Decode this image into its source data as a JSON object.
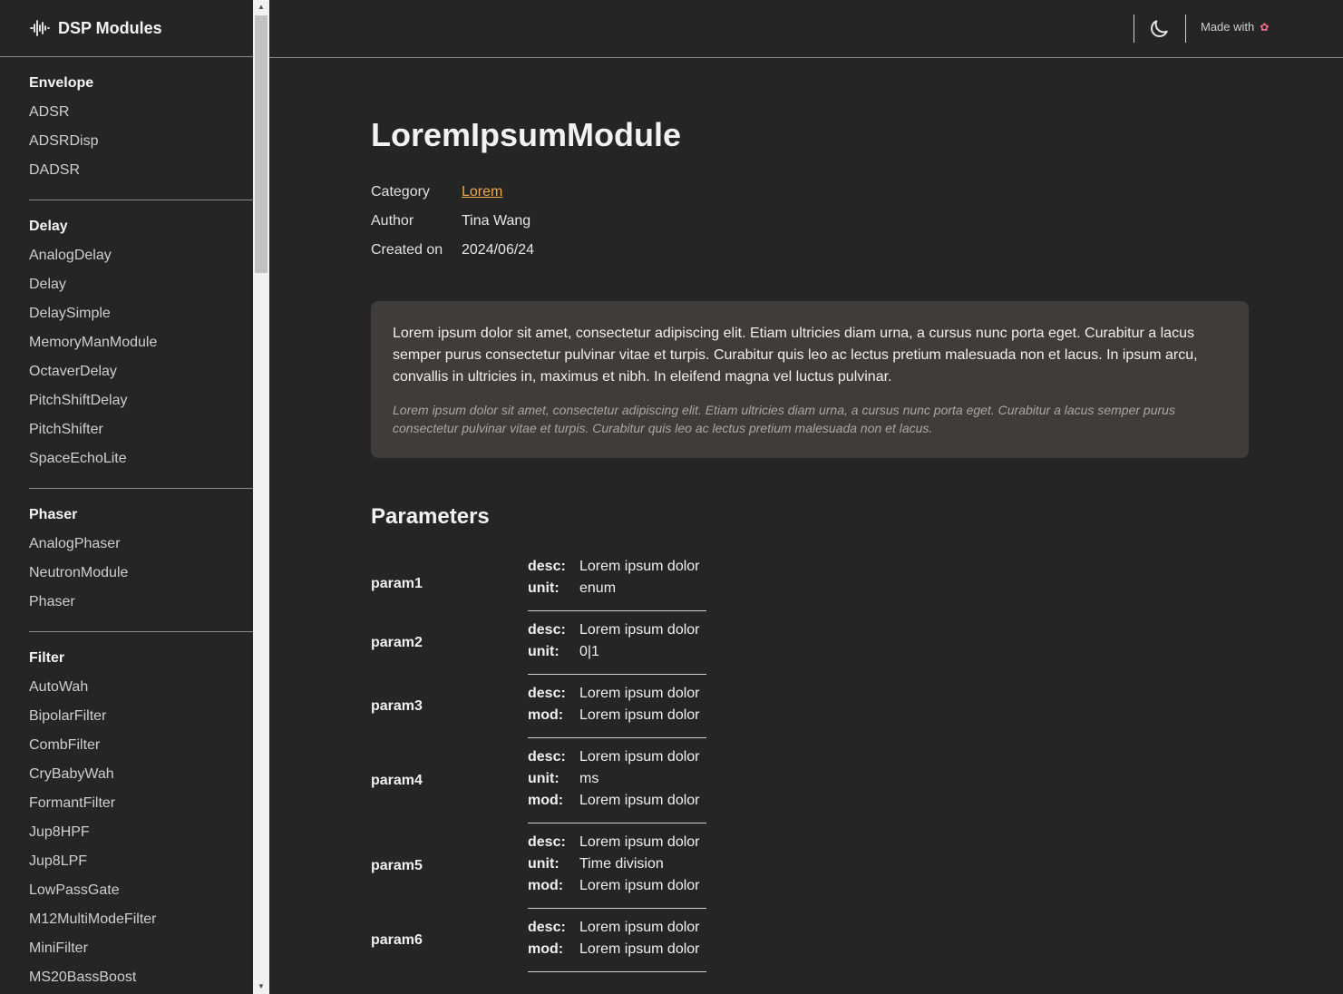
{
  "brand": {
    "title": "DSP Modules",
    "icon": "waveform-icon"
  },
  "sidebar": {
    "groups": [
      {
        "title": "Envelope",
        "items": [
          "ADSR",
          "ADSRDisp",
          "DADSR"
        ]
      },
      {
        "title": "Delay",
        "items": [
          "AnalogDelay",
          "Delay",
          "DelaySimple",
          "MemoryManModule",
          "OctaverDelay",
          "PitchShiftDelay",
          "PitchShifter",
          "SpaceEchoLite"
        ]
      },
      {
        "title": "Phaser",
        "items": [
          "AnalogPhaser",
          "NeutronModule",
          "Phaser"
        ]
      },
      {
        "title": "Filter",
        "items": [
          "AutoWah",
          "BipolarFilter",
          "CombFilter",
          "CryBabyWah",
          "FormantFilter",
          "Jup8HPF",
          "Jup8LPF",
          "LowPassGate",
          "M12MultiModeFilter",
          "MiniFilter",
          "MS20BassBoost"
        ]
      }
    ]
  },
  "header": {
    "made_with": "Made with",
    "heart_icon": "heart-icon",
    "theme_icon": "moon-icon"
  },
  "page": {
    "title": "LoremIpsumModule",
    "meta": [
      {
        "key": "Category",
        "value": "Lorem",
        "link": true
      },
      {
        "key": "Author",
        "value": "Tina Wang",
        "link": false
      },
      {
        "key": "Created on",
        "value": "2024/06/24",
        "link": false
      }
    ],
    "description": "Lorem ipsum dolor sit amet, consectetur adipiscing elit. Etiam ultricies diam urna, a cursus nunc porta eget. Curabitur a lacus semper purus consectetur pulvinar vitae et turpis. Curabitur quis leo ac lectus pretium malesuada non et lacus. In ipsum arcu, convallis in ultricies in, maximus et nibh. In eleifend magna vel luctus pulvinar.",
    "description_italic": "Lorem ipsum dolor sit amet, consectetur adipiscing elit. Etiam ultricies diam urna, a cursus nunc porta eget. Curabitur a lacus semper purus consectetur pulvinar vitae et turpis. Curabitur quis leo ac lectus pretium malesuada non et lacus.",
    "parameters_title": "Parameters",
    "parameters": [
      {
        "name": "param1",
        "fields": [
          {
            "k": "desc:",
            "v": "Lorem ipsum dolor"
          },
          {
            "k": "unit:",
            "v": "enum"
          }
        ]
      },
      {
        "name": "param2",
        "fields": [
          {
            "k": "desc:",
            "v": "Lorem ipsum dolor"
          },
          {
            "k": "unit:",
            "v": "0|1"
          }
        ]
      },
      {
        "name": "param3",
        "fields": [
          {
            "k": "desc:",
            "v": "Lorem ipsum dolor"
          },
          {
            "k": "mod:",
            "v": "Lorem ipsum dolor"
          }
        ]
      },
      {
        "name": "param4",
        "fields": [
          {
            "k": "desc:",
            "v": "Lorem ipsum dolor"
          },
          {
            "k": "unit:",
            "v": "ms"
          },
          {
            "k": "mod:",
            "v": "Lorem ipsum dolor"
          }
        ]
      },
      {
        "name": "param5",
        "fields": [
          {
            "k": "desc:",
            "v": "Lorem ipsum dolor"
          },
          {
            "k": "unit:",
            "v": "Time division"
          },
          {
            "k": "mod:",
            "v": "Lorem ipsum dolor"
          }
        ]
      },
      {
        "name": "param6",
        "fields": [
          {
            "k": "desc:",
            "v": "Lorem ipsum dolor"
          },
          {
            "k": "mod:",
            "v": "Lorem ipsum dolor"
          }
        ]
      }
    ]
  },
  "colors": {
    "background": "#252525",
    "accent_link": "#f0a64d",
    "desc_box": "#403c3a"
  }
}
